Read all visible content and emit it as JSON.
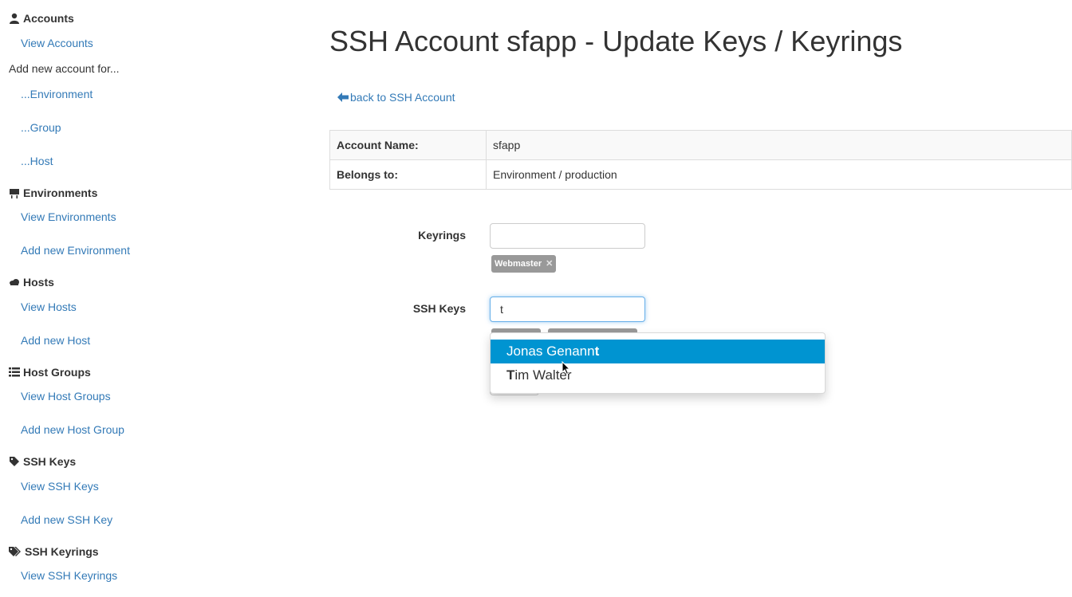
{
  "sidebar": {
    "accounts": {
      "title": "Accounts",
      "view": "View Accounts",
      "add_for": "Add new account for...",
      "env": "...Environment",
      "group": "...Group",
      "host": "...Host"
    },
    "environments": {
      "title": "Environments",
      "view": "View Environments",
      "add": "Add new Environment"
    },
    "hosts": {
      "title": "Hosts",
      "view": "View Hosts",
      "add": "Add new Host"
    },
    "host_groups": {
      "title": "Host Groups",
      "view": "View Host Groups",
      "add": "Add new Host Group"
    },
    "ssh_keys": {
      "title": "SSH Keys",
      "view": "View SSH Keys",
      "add": "Add new SSH Key"
    },
    "ssh_keyrings": {
      "title": "SSH Keyrings",
      "view": "View SSH Keyrings"
    }
  },
  "main": {
    "title": "SSH Account sfapp - Update Keys / Keyrings",
    "back_link": "back to SSH Account",
    "info": {
      "account_name_label": "Account Name:",
      "account_name_value": "sfapp",
      "belongs_to_label": "Belongs to:",
      "belongs_to_value": "Environment / production"
    },
    "form": {
      "keyrings_label": "Keyrings",
      "keyrings_input_value": "",
      "keyring_tags": [
        "Webmaster"
      ],
      "ssh_keys_label": "SSH Keys",
      "ssh_keys_input_value": "t",
      "suggestions": [
        {
          "pre": "Jonas Genann",
          "match": "t",
          "post": "",
          "active": true
        },
        {
          "pre": "",
          "match": "T",
          "post": "im Walter",
          "active": false
        }
      ]
    }
  },
  "colors": {
    "link": "#337ab7",
    "tag": "#999999",
    "active_suggestion": "#0094d1"
  }
}
